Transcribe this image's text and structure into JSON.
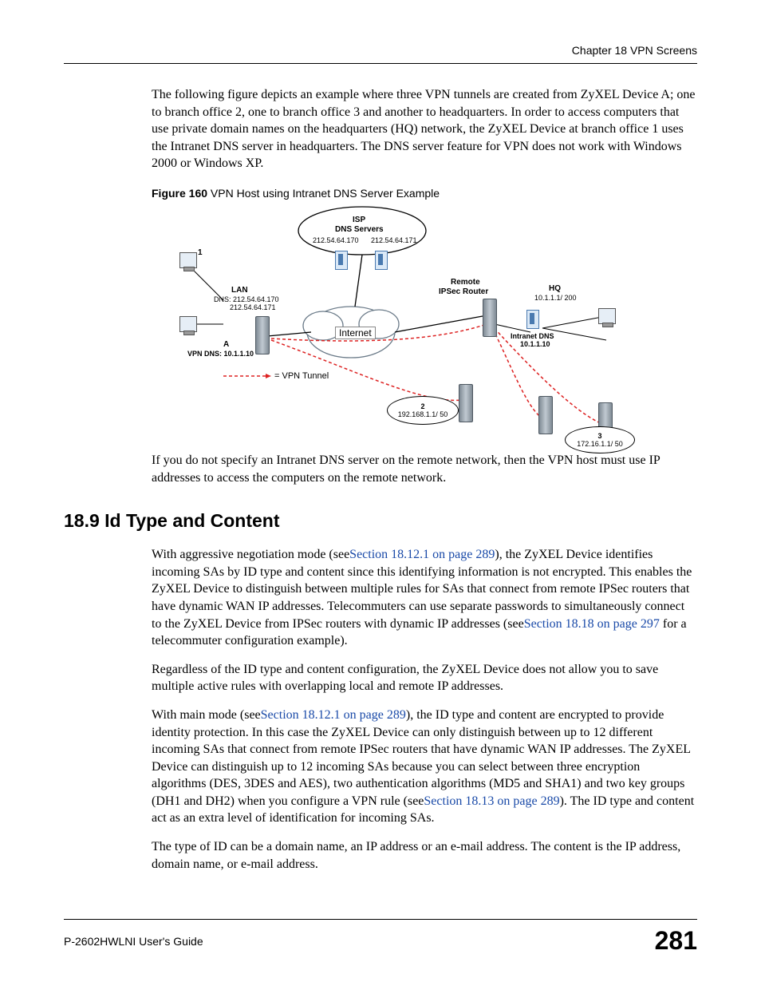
{
  "header": {
    "chapter": "Chapter 18 VPN Screens"
  },
  "intro_para": "The following figure depicts an example where three VPN tunnels are created from ZyXEL Device A; one to branch office 2, one to branch office 3 and another to headquarters. In order to access computers that use private domain names on the headquarters (HQ) network, the ZyXEL Device at branch office 1 uses the Intranet DNS server in headquarters. The DNS server feature for VPN does not work with Windows 2000 or Windows XP.",
  "figure": {
    "label_bold": "Figure 160",
    "label_rest": "   VPN Host using Intranet DNS Server Example",
    "isp": "ISP",
    "dns_servers": "DNS Servers",
    "dns_ip1": "212.54.64.170",
    "dns_ip2": "212.54.64.171",
    "one": "1",
    "lan": "LAN",
    "lan_dns1": "DNS: 212.54.64.170",
    "lan_dns2": "212.54.64.171",
    "a": "A",
    "vpn_dns": "VPN DNS: 10.1.1.10",
    "internet": "Internet",
    "vpn_tunnel": "= VPN Tunnel",
    "remote_router": "Remote",
    "ipsec_router": "IPSec Router",
    "hq": "HQ",
    "hq_ip": "10.1.1.1/ 200",
    "intranet_dns": "Intranet DNS",
    "intranet_ip": "10.1.1.10",
    "node2": "2",
    "node2_ip": "192.168.1.1/ 50",
    "node3": "3",
    "node3_ip": "172.16.1.1/ 50"
  },
  "after_fig": "If you do not specify an Intranet DNS server on the remote network, then the VPN host must use IP addresses to access the computers on the remote network.",
  "heading": "18.9  Id Type and Content",
  "p1_a": "With aggressive negotiation mode (see",
  "link1": "Section 18.12.1 on page 289",
  "p1_b": "), the ZyXEL Device identifies incoming SAs by ID type and content since this identifying information is not encrypted. This enables the ZyXEL Device to distinguish between multiple rules for SAs that connect from remote IPSec routers that have dynamic WAN IP addresses. Telecommuters can use separate passwords to simultaneously connect to the ZyXEL Device from IPSec routers with dynamic IP addresses (see",
  "link2": "Section 18.18 on page 297",
  "p1_c": " for a telecommuter configuration example).",
  "p2": "Regardless of the ID type and content configuration, the ZyXEL Device does not allow you to save multiple active rules with overlapping local and remote IP addresses.",
  "p3_a": "With main mode (see",
  "link3": "Section 18.12.1 on page 289",
  "p3_b": "), the ID type and content are encrypted to provide identity protection. In this case the ZyXEL Device can only distinguish between up to 12 different incoming SAs that connect from remote IPSec routers that have dynamic WAN IP addresses. The ZyXEL Device can distinguish up to 12 incoming SAs because you can select between three encryption algorithms (DES, 3DES and AES), two authentication algorithms (MD5 and SHA1) and two key groups (DH1 and DH2) when you configure a VPN rule (see",
  "link4": "Section 18.13 on page 289",
  "p3_c": "). The ID type and content act as an extra level of identification for incoming SAs.",
  "p4": "The type of ID can be a domain name, an IP address or an e-mail address. The content is the IP address, domain name, or e-mail address.",
  "footer": {
    "guide": "P-2602HWLNI User's Guide",
    "page": "281"
  }
}
